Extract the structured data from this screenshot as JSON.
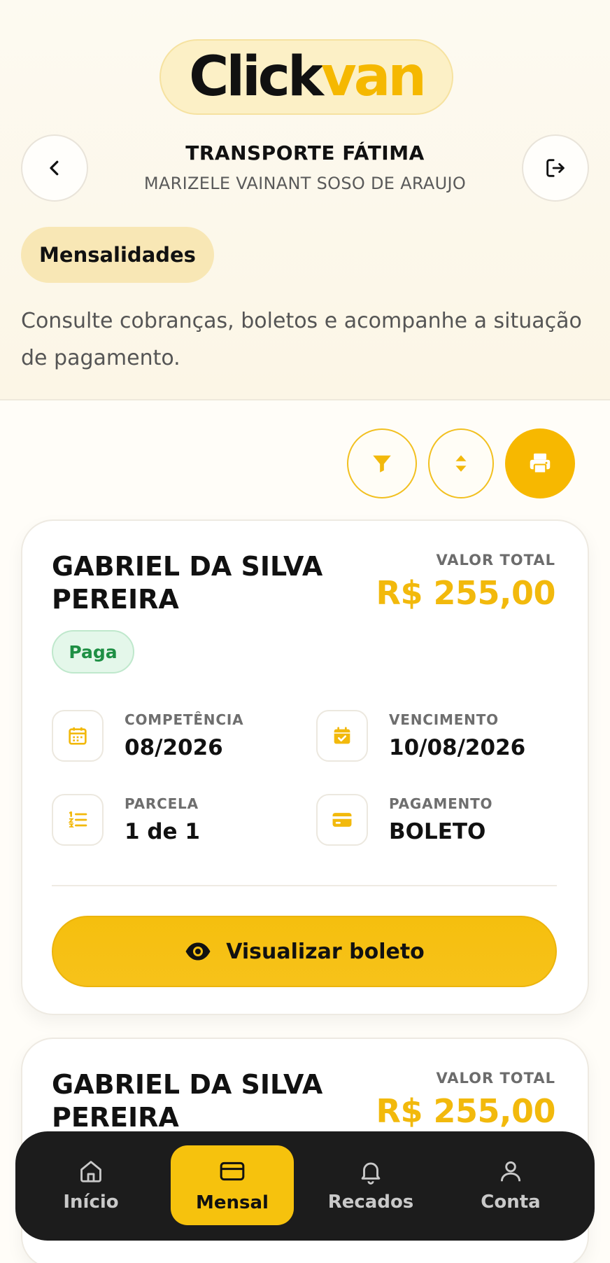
{
  "app": {
    "logo_part1": "Click",
    "logo_part2": "van",
    "org_name": "TRANSPORTE FÁTIMA",
    "user_name": "MARIZELE VAINANT SOSO DE ARAUJO"
  },
  "page": {
    "section_title": "Mensalidades",
    "description": "Consulte cobranças, boletos e acompanhe a situação de pagamento."
  },
  "toolbar": {
    "filter_icon": "filter-icon",
    "sort_icon": "sort-icon",
    "print_icon": "print-icon"
  },
  "cards": [
    {
      "name": "GABRIEL DA SILVA PEREIRA",
      "total_label": "VALOR TOTAL",
      "total_value": "R$ 255,00",
      "status": "Paga",
      "competencia_label": "COMPETÊNCIA",
      "competencia": "08/2026",
      "vencimento_label": "VENCIMENTO",
      "vencimento": "10/08/2026",
      "parcela_label": "PARCELA",
      "parcela": "1 de 1",
      "pagamento_label": "PAGAMENTO",
      "pagamento": "BOLETO",
      "action_label": "Visualizar boleto"
    },
    {
      "name": "GABRIEL DA SILVA PEREIRA",
      "total_label": "VALOR TOTAL",
      "total_value": "R$ 255,00"
    }
  ],
  "nav": {
    "items": [
      {
        "label": "Início",
        "icon": "home-icon",
        "active": false
      },
      {
        "label": "Mensal",
        "icon": "card-icon",
        "active": true
      },
      {
        "label": "Recados",
        "icon": "bell-icon",
        "active": false
      },
      {
        "label": "Conta",
        "icon": "user-icon",
        "active": false
      }
    ]
  },
  "colors": {
    "accent": "#f5b800",
    "status_paid": "#1e8f44",
    "nav_bg": "#1c1c1c"
  }
}
